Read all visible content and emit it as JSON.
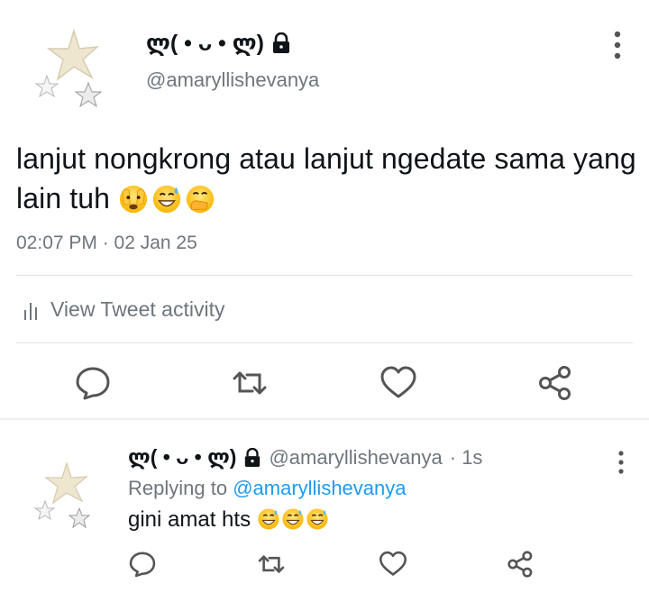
{
  "main_tweet": {
    "display_name": "ლ( • ᴗ • ლ)",
    "handle": "@amaryllishevanya",
    "text": "lanjut nongkrong atau lanjut ngedate sama yang lain tuh",
    "timestamp": "02:07 PM · 02 Jan 25",
    "activity_label": "View Tweet activity"
  },
  "reply_tweet": {
    "display_name": "ლ( • ᴗ • ლ)",
    "handle": "@amaryllishevanya",
    "time": "· 1s",
    "replying_prefix": "Replying to",
    "replying_to": "@amaryllishevanya",
    "text": "gini amat hts"
  },
  "icons": {
    "avatar": "stars-avatar",
    "lock": "lock-icon",
    "more": "more-vertical-icon",
    "reply": "reply-icon",
    "retweet": "retweet-icon",
    "like": "heart-icon",
    "share": "share-icon",
    "activity": "bar-chart-icon",
    "emoji_main": [
      "face-peeking-icon",
      "grinning-sweat-icon",
      "hand-over-mouth-icon"
    ],
    "emoji_reply": [
      "grinning-sweat-icon",
      "grinning-sweat-icon",
      "grinning-sweat-icon"
    ]
  },
  "colors": {
    "text": "#0f1419",
    "muted": "#6e767d",
    "link": "#1d9bf0",
    "divider": "#dfe3e6"
  }
}
